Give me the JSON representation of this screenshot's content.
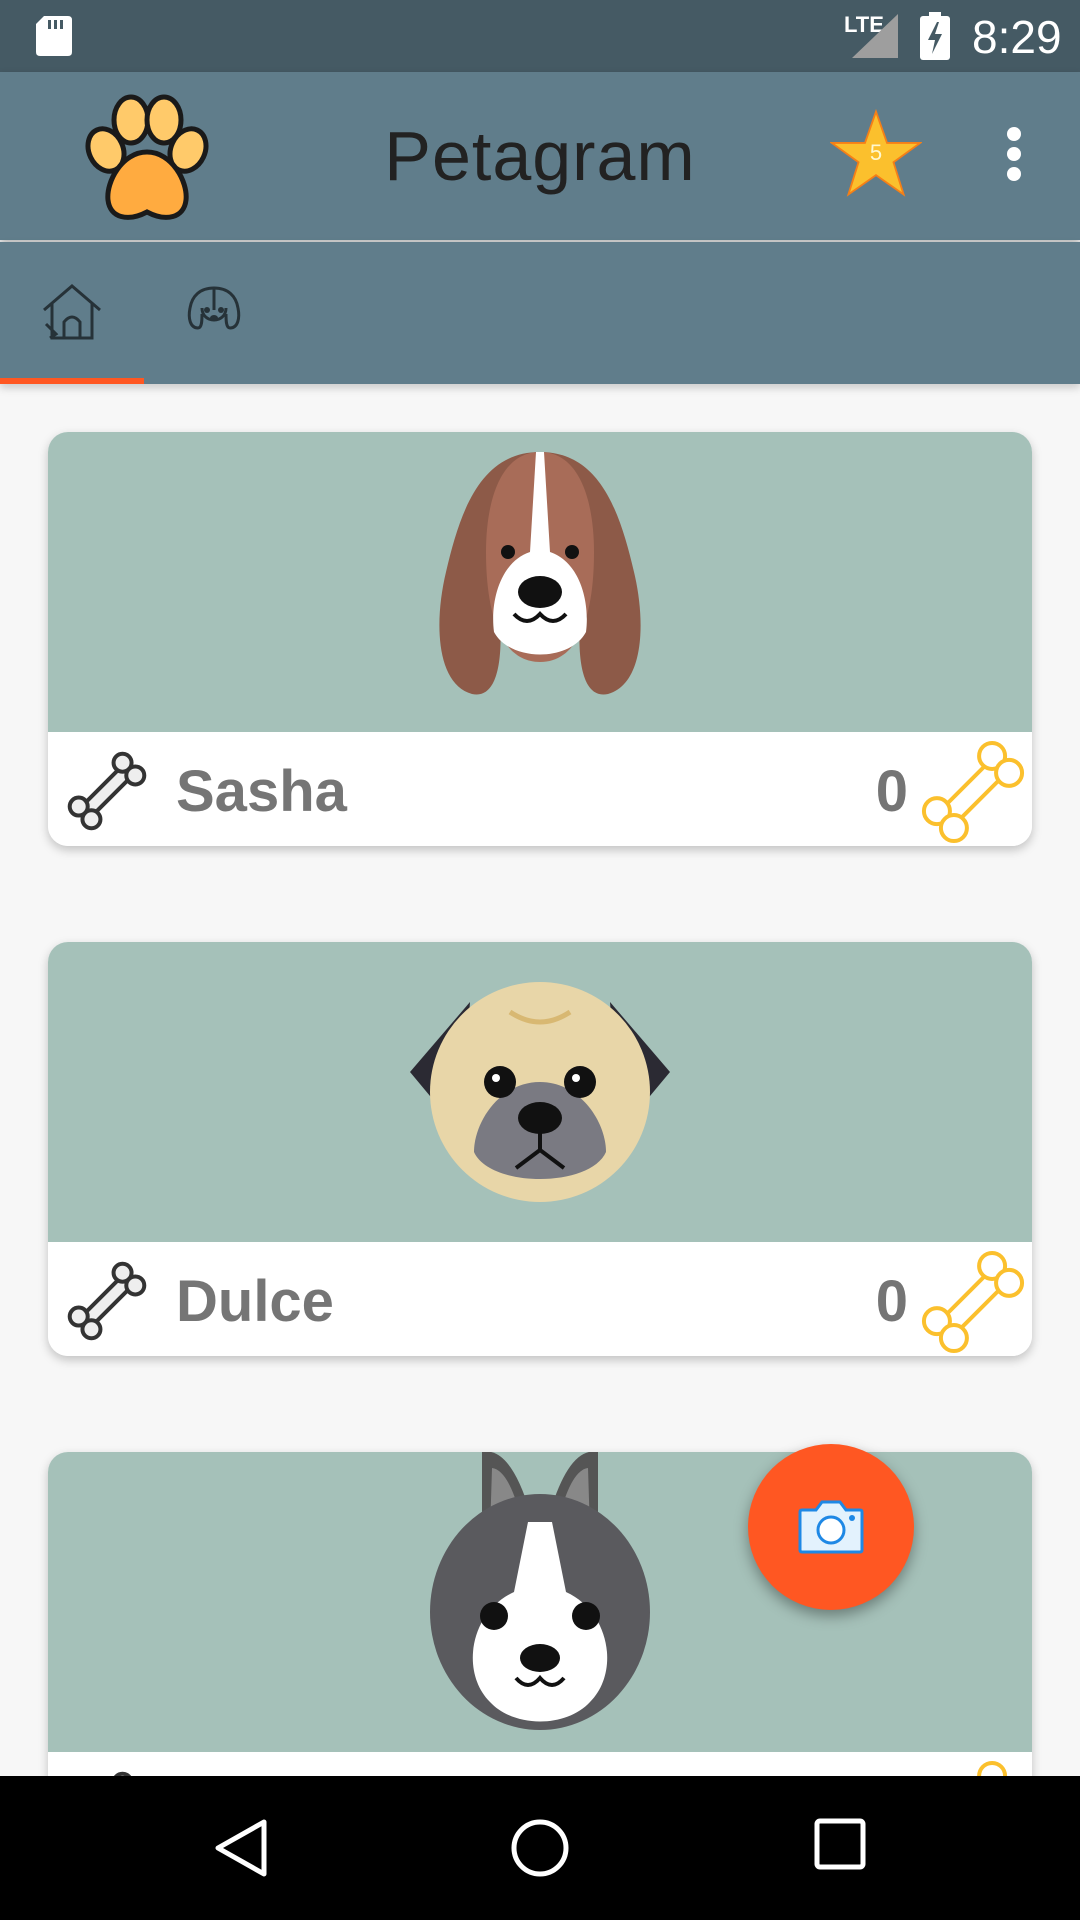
{
  "status_bar": {
    "network": "LTE",
    "time": "8:29"
  },
  "app_bar": {
    "title": "Petagram",
    "favorites_count": "5",
    "icons": {
      "logo": "paw-logo-icon",
      "favorites": "star-icon",
      "menu": "more-vert-icon"
    }
  },
  "tabs": [
    {
      "icon": "home-doghouse-icon",
      "selected": true
    },
    {
      "icon": "dog-profile-icon",
      "selected": false
    }
  ],
  "pets": [
    {
      "name": "Sasha",
      "likes": "0",
      "avatar": "beagle-avatar"
    },
    {
      "name": "Dulce",
      "likes": "0",
      "avatar": "pug-avatar"
    },
    {
      "name": "",
      "likes": "",
      "avatar": "boston-terrier-avatar"
    }
  ],
  "fab": {
    "icon": "camera-icon"
  },
  "nav_bar": {
    "icons": [
      "back-icon",
      "home-icon",
      "recents-icon"
    ]
  },
  "colors": {
    "status_bar": "#455a64",
    "app_bar": "#607d8b",
    "accent": "#ff5722",
    "card_photo_bg": "#a5c1b9",
    "text_secondary": "#757575"
  }
}
